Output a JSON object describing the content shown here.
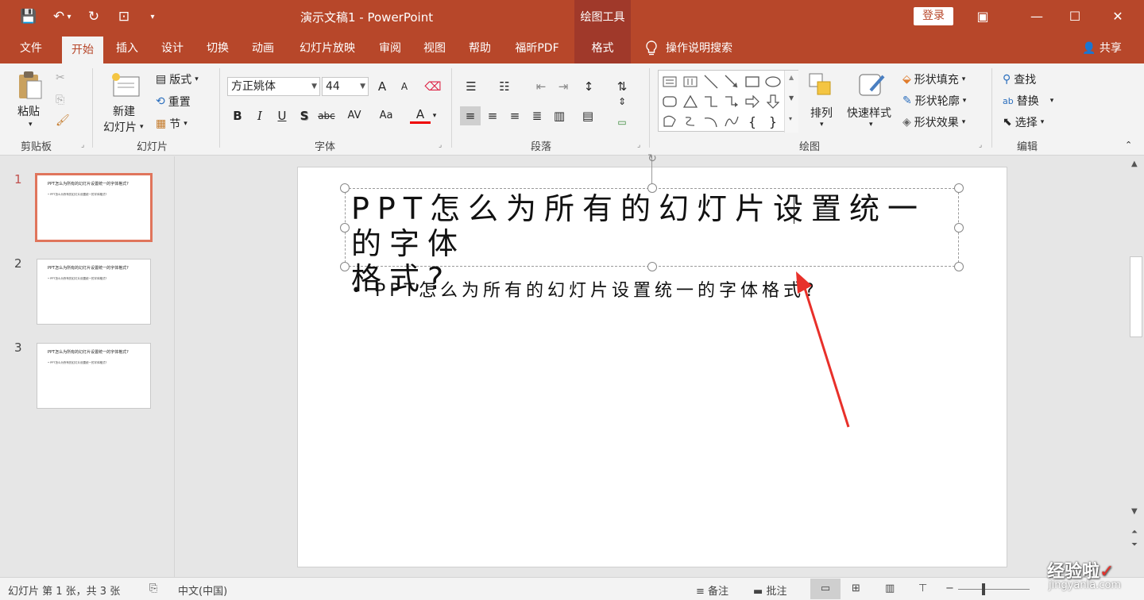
{
  "window": {
    "title": "演示文稿1  -  PowerPoint",
    "context_group": "绘图工具",
    "login": "登录",
    "minimize": "—",
    "restore": "☐",
    "close": "✕",
    "ribbon_display": "▣"
  },
  "qat": {
    "save": "💾",
    "undo": "↶",
    "undo_dd": "▾",
    "redo": "↻",
    "present": "⊡",
    "customize": "▾"
  },
  "tabs": [
    {
      "label": "文件"
    },
    {
      "label": "开始"
    },
    {
      "label": "插入"
    },
    {
      "label": "设计"
    },
    {
      "label": "切换"
    },
    {
      "label": "动画"
    },
    {
      "label": "幻灯片放映"
    },
    {
      "label": "审阅"
    },
    {
      "label": "视图"
    },
    {
      "label": "帮助"
    },
    {
      "label": "福昕PDF"
    },
    {
      "label": "格式"
    }
  ],
  "tell_me": "操作说明搜索",
  "share": "共享",
  "ribbon": {
    "clipboard": {
      "label": "剪贴板",
      "paste": "粘贴"
    },
    "slides": {
      "label": "幻灯片",
      "new_slide_1": "新建",
      "new_slide_2": "幻灯片",
      "layout": "版式",
      "reset": "重置",
      "section": "节"
    },
    "font": {
      "label": "字体",
      "font_name": "方正姚体",
      "font_size": "44",
      "bold": "B",
      "italic": "I",
      "underline": "U",
      "shadow": "S",
      "strike": "abc",
      "spacing": "AV",
      "case": "Aa",
      "color": "A",
      "grow": "A",
      "shrink": "A"
    },
    "paragraph": {
      "label": "段落"
    },
    "drawing": {
      "label": "绘图",
      "arrange": "排列",
      "quick_styles": "快速样式",
      "shape_fill": "形状填充",
      "shape_outline": "形状轮廓",
      "shape_effects": "形状效果"
    },
    "editing": {
      "label": "编辑",
      "find": "查找",
      "replace": "替换",
      "select": "选择"
    }
  },
  "thumbnails": [
    {
      "num": "1",
      "title": "PPT怎么为所有的幻灯片设置统一的字体格式?",
      "body": "• PPT怎么为所有的幻灯片设置统一的字体格式?"
    },
    {
      "num": "2",
      "title": "PPT怎么为所有的幻灯片设置统一的字体格式?",
      "body": "• PPT怎么为所有的幻灯片设置统一的字体格式?"
    },
    {
      "num": "3",
      "title": "PPT怎么为所有的幻灯片设置统一的字体格式?",
      "body": "• PPT怎么为所有的幻灯片设置统一的字体格式?"
    }
  ],
  "slide": {
    "title_line1": "PPT怎么为所有的幻灯片设置统一的字体",
    "title_line2": "格式?",
    "bullet": "• PPT怎么为所有的幻灯片设置统一的字体格式?"
  },
  "status": {
    "slide_info": "幻灯片 第 1 张，共 3 张",
    "language": "中文(中国)",
    "notes": "备注",
    "comments": "批注"
  },
  "watermark": {
    "line1": "经验啦",
    "check": "✓",
    "line2": "jingyanla.com"
  },
  "colors": {
    "accent": "#b7472a",
    "arrow": "#e8302a",
    "thumb_select": "#e0755c"
  }
}
